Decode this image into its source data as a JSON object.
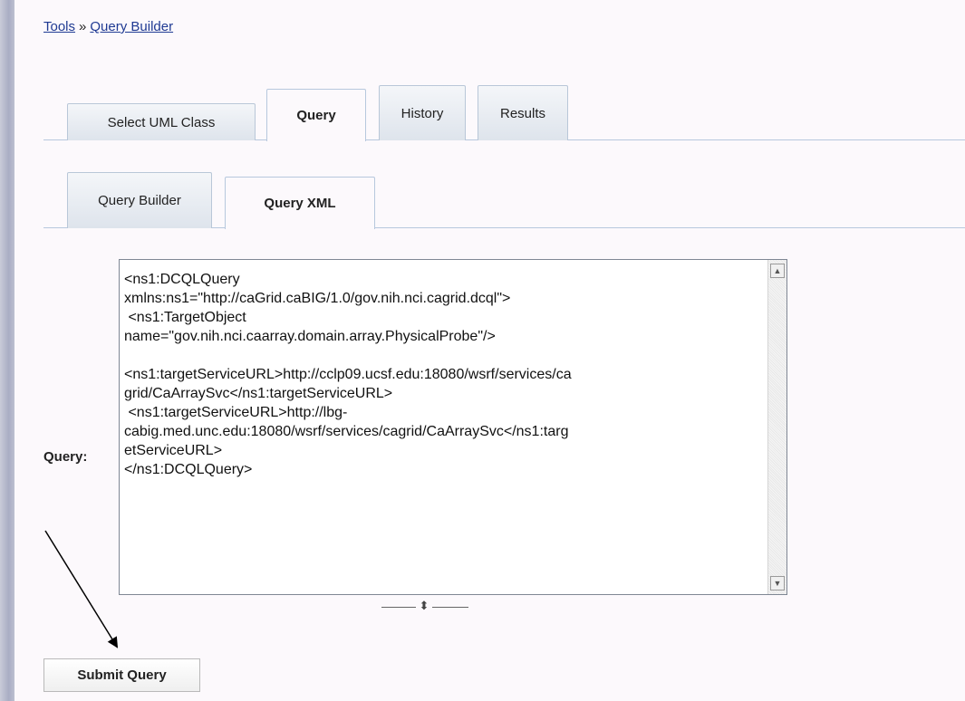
{
  "breadcrumb": {
    "tools": "Tools",
    "separator": "»",
    "query_builder": "Query Builder"
  },
  "main_tabs": [
    {
      "label": "Select UML Class",
      "active": false
    },
    {
      "label": "Query",
      "active": true
    },
    {
      "label": "History",
      "active": false
    },
    {
      "label": "Results",
      "active": false
    }
  ],
  "sub_tabs": [
    {
      "label": "Query Builder",
      "active": false
    },
    {
      "label": "Query XML",
      "active": true
    }
  ],
  "query": {
    "label": "Query:",
    "text": "<ns1:DCQLQuery\nxmlns:ns1=\"http://caGrid.caBIG/1.0/gov.nih.nci.cagrid.dcql\">\n <ns1:TargetObject\nname=\"gov.nih.nci.caarray.domain.array.PhysicalProbe\"/>\n\n<ns1:targetServiceURL>http://cclp09.ucsf.edu:18080/wsrf/services/ca\ngrid/CaArraySvc</ns1:targetServiceURL>\n <ns1:targetServiceURL>http://lbg-\ncabig.med.unc.edu:18080/wsrf/services/cagrid/CaArraySvc</ns1:targ\netServiceURL>\n</ns1:DCQLQuery>"
  },
  "scroll_up_icon": "▲",
  "scroll_down_icon": "▼",
  "resize_icon": "⬍",
  "submit_label": "Submit Query"
}
